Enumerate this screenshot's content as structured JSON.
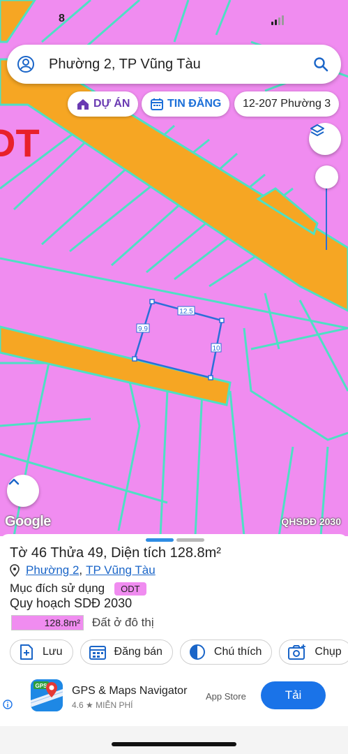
{
  "status": {
    "time": "8"
  },
  "search": {
    "query": "Phường 2, TP Vũng Tàu"
  },
  "chips": [
    {
      "label": "DỰ ÁN"
    },
    {
      "label": "TIN ĐĂNG"
    },
    {
      "label": "12-207 Phường 3"
    }
  ],
  "map": {
    "zone_label": "DT",
    "edge_labels": [
      "12.5",
      "9.9",
      "10"
    ],
    "attribution": "Google",
    "layer_label": "QHSDĐ 2030",
    "colors": {
      "residential": "#f08cf0",
      "road": "#f6a623",
      "parcel_outline": "#2a6fd8",
      "lot_lines": "#4ee0c4"
    }
  },
  "sheet": {
    "title": "Tờ 46 Thửa 49, Diện tích 128.8m²",
    "ward_link": "Phường 2",
    "city_link": "TP Vũng Tàu",
    "comma": ",",
    "purpose_label": "Mục đích sử dụng",
    "purpose_badge": "ODT",
    "plan_label": "Quy hoạch SDĐ 2030",
    "area_value": "128.8m²",
    "area_type": "Đất ở đô thị",
    "actions": [
      "Lưu",
      "Đăng bán",
      "Chú thích",
      "Chụp"
    ]
  },
  "ad": {
    "app_name": "GPS & Maps Navigator",
    "rating": "4.6",
    "price": "MIỄN PHÍ",
    "icon_text": "GPS",
    "store": "App Store",
    "install_label": "Tải"
  }
}
